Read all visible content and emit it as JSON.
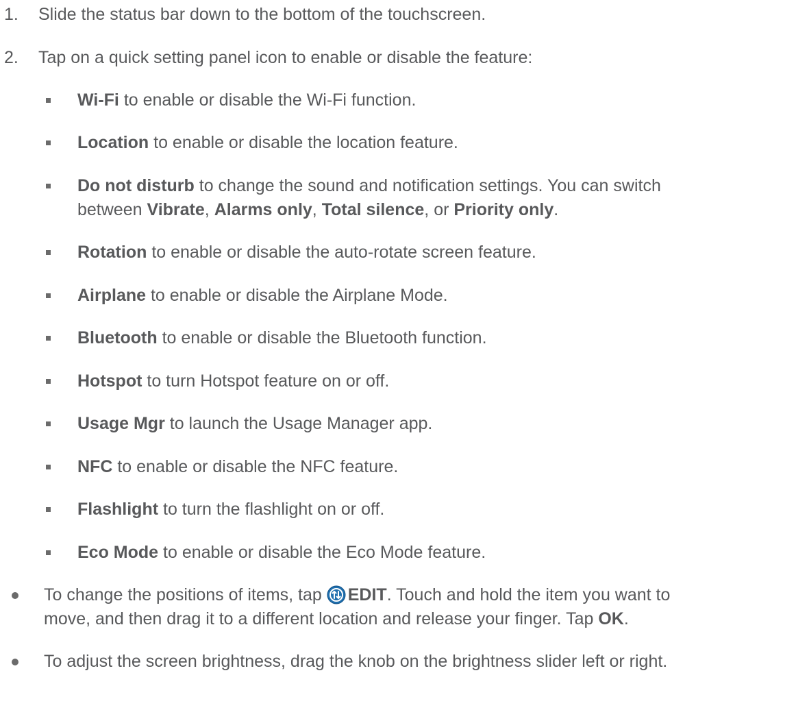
{
  "steps": [
    {
      "num": "1.",
      "text": "Slide the status bar down to the bottom of the touchscreen."
    },
    {
      "num": "2.",
      "text": "Tap on a quick setting panel icon to enable or disable the feature:"
    }
  ],
  "items": [
    {
      "term": "Wi-Fi",
      "desc": " to enable or disable the Wi-Fi function."
    },
    {
      "term": "Location",
      "desc": " to enable or disable the location feature."
    },
    {
      "term": "Do not disturb",
      "desc": " to change the sound and notification settings. You can switch",
      "line2": {
        "pre": "between ",
        "t1": "Vibrate",
        "s1": ", ",
        "t2": "Alarms only",
        "s2": ", ",
        "t3": "Total silence",
        "s3": ", or ",
        "t4": "Priority only",
        "end": "."
      }
    },
    {
      "term": "Rotation",
      "desc": " to enable or disable the auto-rotate screen feature."
    },
    {
      "term": "Airplane",
      "desc": " to enable or disable the Airplane Mode."
    },
    {
      "term": "Bluetooth",
      "desc": " to enable or disable the Bluetooth function."
    },
    {
      "term": "Hotspot",
      "desc": " to turn Hotspot feature on or off."
    },
    {
      "term": "Usage Mgr",
      "desc": " to launch the Usage Manager app."
    },
    {
      "term": "NFC",
      "desc": " to enable or disable the NFC feature."
    },
    {
      "term": "Flashlight",
      "desc": " to turn the flashlight on or off."
    },
    {
      "term": "Eco Mode",
      "desc": " to enable or disable the Eco Mode feature."
    }
  ],
  "bullets": {
    "edit": {
      "pre": "To change the positions of items, tap ",
      "icon": "edit-arrows-icon",
      "label": "EDIT",
      "post": ". Touch and hold the item you want to",
      "line2_pre": "move, and then drag it to a different location and release your finger. Tap ",
      "ok": "OK",
      "line2_end": "."
    },
    "brightness": "To adjust the screen brightness, drag the knob on the brightness slider left or right."
  },
  "colors": {
    "text": "#58595b",
    "icon_bg": "#1f6fae",
    "marker": "#6b6b6b"
  }
}
